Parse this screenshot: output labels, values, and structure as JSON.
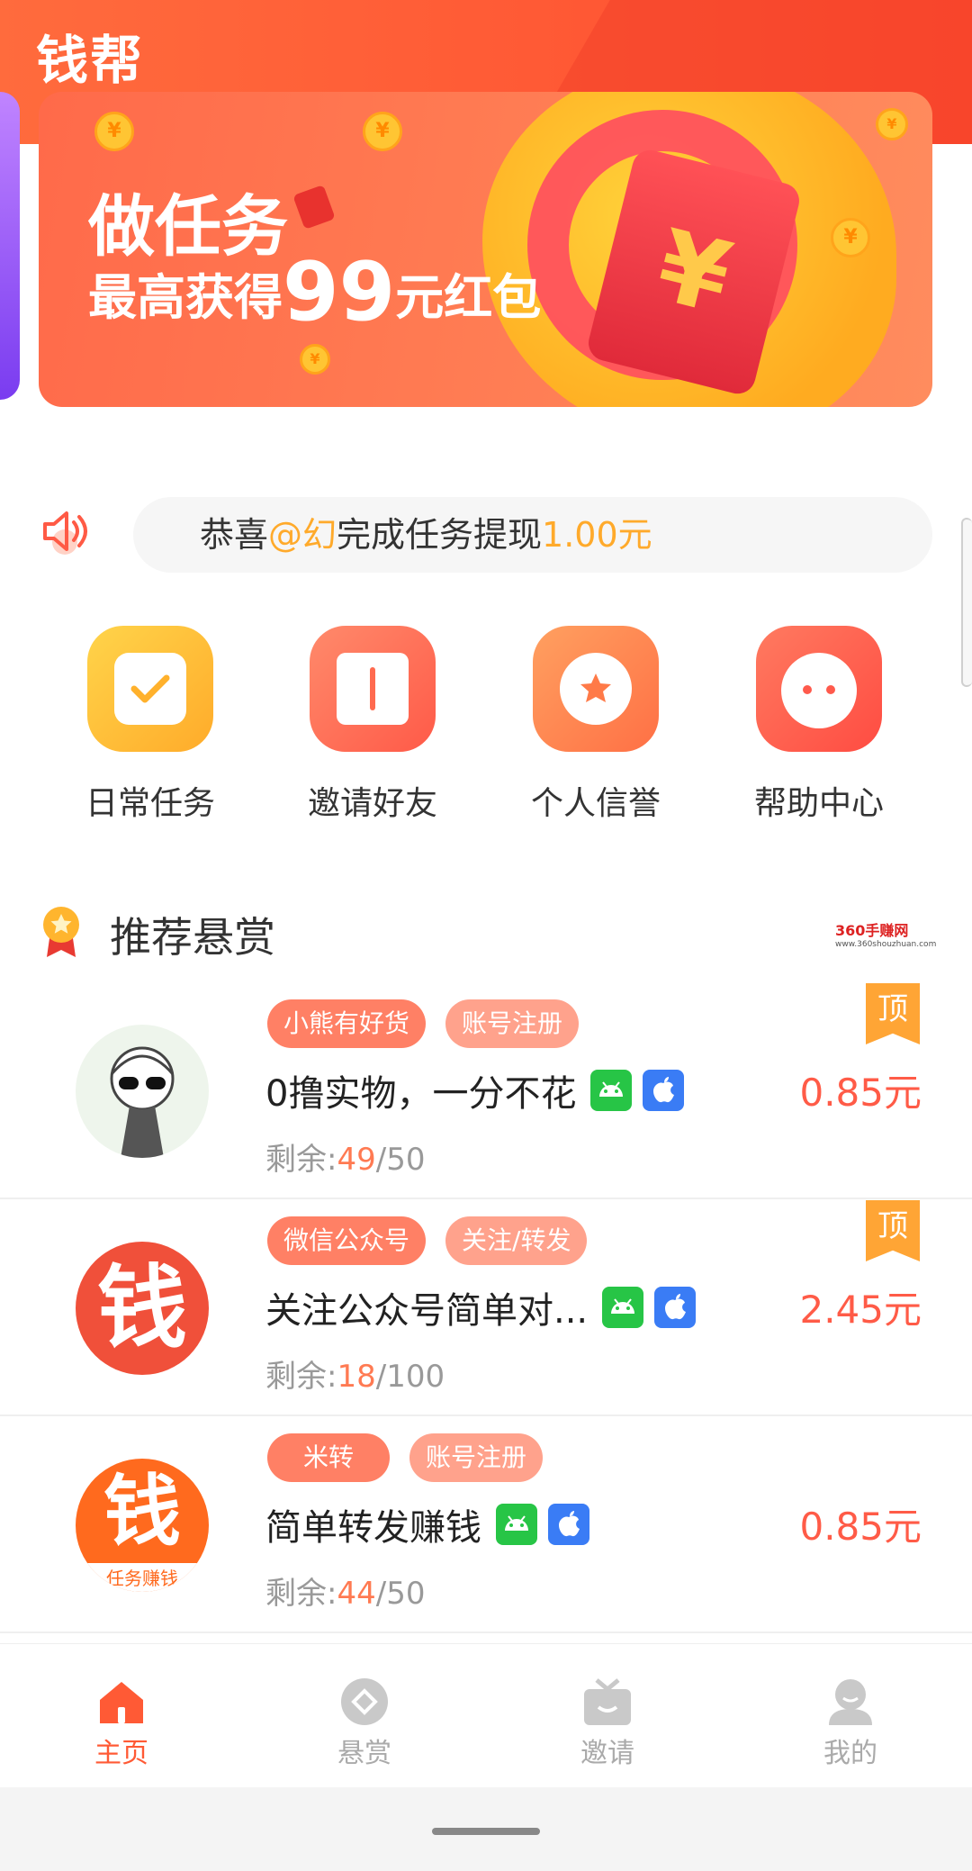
{
  "app": {
    "title": "钱帮"
  },
  "banner": {
    "line1": "做任务",
    "line2_prefix": "最高获得",
    "line2_amount": "99",
    "line2_suffix": "元红包"
  },
  "notice": {
    "prefix": "恭喜",
    "user": "@幻",
    "middle": "完成任务提现",
    "amount": "1.00元"
  },
  "quick_menu": [
    {
      "label": "日常任务",
      "icon": "calendar-check-icon",
      "color": "#ffc23a"
    },
    {
      "label": "邀请好友",
      "icon": "gift-icon",
      "color": "#ff6a4f"
    },
    {
      "label": "个人信誉",
      "icon": "star-badge-icon",
      "color": "#ff8a4d"
    },
    {
      "label": "帮助中心",
      "icon": "headset-icon",
      "color": "#ff5a4c"
    }
  ],
  "section": {
    "title": "推荐悬赏"
  },
  "watermark": {
    "title": "360手赚网",
    "url": "www.360shouzhuan.com"
  },
  "tasks": [
    {
      "tags": [
        "小熊有好货",
        "账号注册"
      ],
      "title": "0撸实物，一分不花",
      "remain_label": "剩余:",
      "remain": "49",
      "total": "/50",
      "price": "0.85元",
      "pinned": true,
      "pin_label": "顶"
    },
    {
      "tags": [
        "微信公众号",
        "关注/转发"
      ],
      "title": "关注公众号简单对...",
      "remain_label": "剩余:",
      "remain": "18",
      "total": "/100",
      "price": "2.45元",
      "pinned": true,
      "pin_label": "顶"
    },
    {
      "tags": [
        "米转",
        "账号注册"
      ],
      "title": "简单转发赚钱",
      "remain_label": "剩余:",
      "remain": "44",
      "total": "/50",
      "price": "0.85元",
      "pinned": false,
      "avatar_caption": "任务赚钱"
    }
  ],
  "avatars": {
    "money_char": "钱"
  },
  "tabbar": [
    {
      "label": "主页",
      "icon": "home-icon",
      "active": true
    },
    {
      "label": "悬赏",
      "icon": "bounty-icon",
      "active": false
    },
    {
      "label": "邀请",
      "icon": "invite-gift-icon",
      "active": false
    },
    {
      "label": "我的",
      "icon": "profile-icon",
      "active": false
    }
  ],
  "colors": {
    "brand": "#ff5a35",
    "price": "#ff5b47",
    "highlight": "#ffaa2b",
    "tag": "#ff8065",
    "pin": "#ffa535"
  }
}
